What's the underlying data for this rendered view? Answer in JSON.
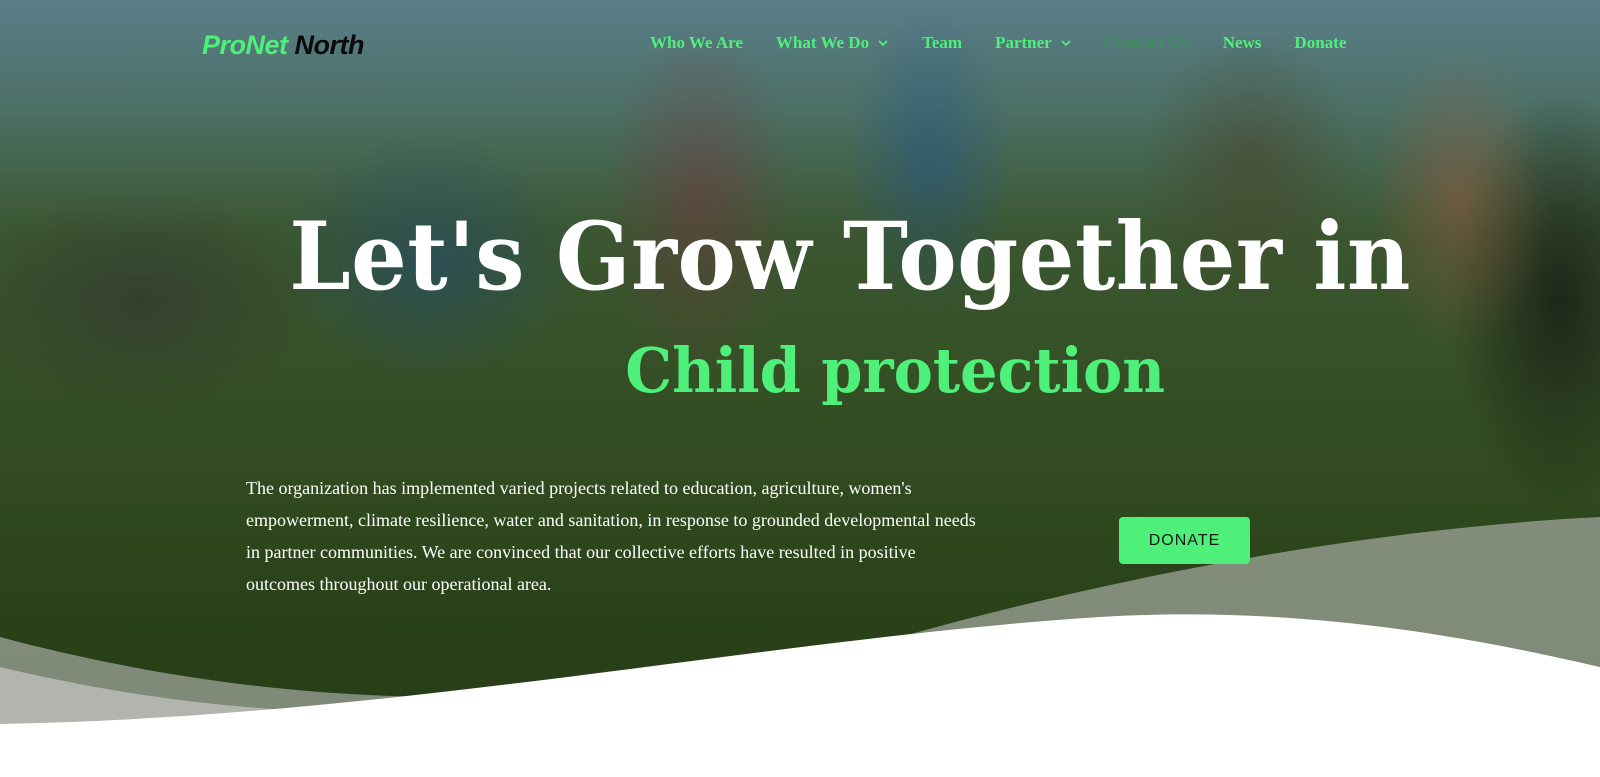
{
  "brand": {
    "part1": "ProNet",
    "part2": "North"
  },
  "nav": {
    "items": [
      {
        "label": "Who We Are",
        "has_dropdown": false
      },
      {
        "label": "What We Do",
        "has_dropdown": true
      },
      {
        "label": "Team",
        "has_dropdown": false
      },
      {
        "label": "Partner",
        "has_dropdown": true
      },
      {
        "label": "Contact Us",
        "has_dropdown": false,
        "active": true
      },
      {
        "label": "News",
        "has_dropdown": false
      },
      {
        "label": "Donate",
        "has_dropdown": false
      }
    ]
  },
  "hero": {
    "headline": "Let's Grow Together in",
    "subheadline": "Child protection",
    "description": "The organization has implemented varied projects related to education, agriculture, women's empowerment, climate resilience, water and sanitation, in response to grounded developmental needs in partner communities. We are convinced that our collective efforts have resulted in positive outcomes throughout our operational area.",
    "cta_label": "DONATE"
  },
  "colors": {
    "accent": "#4ef07a",
    "accent_active": "#2f9a4a",
    "text_light": "#ffffff",
    "logo_dark": "#0a0a0a"
  },
  "icons": {
    "dropdown": "chevron-down-icon"
  }
}
